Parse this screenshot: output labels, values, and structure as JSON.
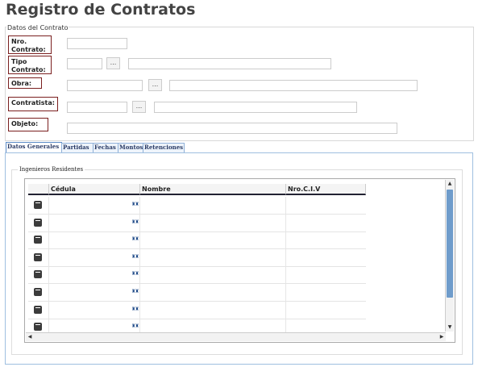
{
  "page": {
    "title": "Registro de Contratos"
  },
  "datos_contrato": {
    "legend": "Datos del Contrato",
    "nro_contrato": {
      "label": "Nro. Contrato:",
      "value": ""
    },
    "tipo_contrato": {
      "label": "Tipo Contrato:",
      "code": "",
      "desc": "",
      "lookup": "..."
    },
    "obra": {
      "label": "Obra:",
      "code": "",
      "desc": "",
      "lookup": "..."
    },
    "contratista": {
      "label": "Contratista:",
      "code": "",
      "desc": "",
      "lookup": "..."
    },
    "objeto": {
      "label": "Objeto:",
      "value": ""
    }
  },
  "tabs": [
    "Datos Generales",
    "Partidas",
    "Fechas",
    "Montos",
    "Retenciones"
  ],
  "ingenieros": {
    "legend": "Ingenieros Residentes",
    "columns": [
      "Cédula",
      "Nombre",
      "Nro.C.I.V"
    ],
    "rows": [
      {
        "cedula": "",
        "nombre": "",
        "civ": ""
      },
      {
        "cedula": "",
        "nombre": "",
        "civ": ""
      },
      {
        "cedula": "",
        "nombre": "",
        "civ": ""
      },
      {
        "cedula": "",
        "nombre": "",
        "civ": ""
      },
      {
        "cedula": "",
        "nombre": "",
        "civ": ""
      },
      {
        "cedula": "",
        "nombre": "",
        "civ": ""
      },
      {
        "cedula": "",
        "nombre": "",
        "civ": ""
      },
      {
        "cedula": "",
        "nombre": "",
        "civ": ""
      }
    ]
  },
  "icons": {
    "delete": "trash-icon",
    "search": "binoculars-icon"
  }
}
